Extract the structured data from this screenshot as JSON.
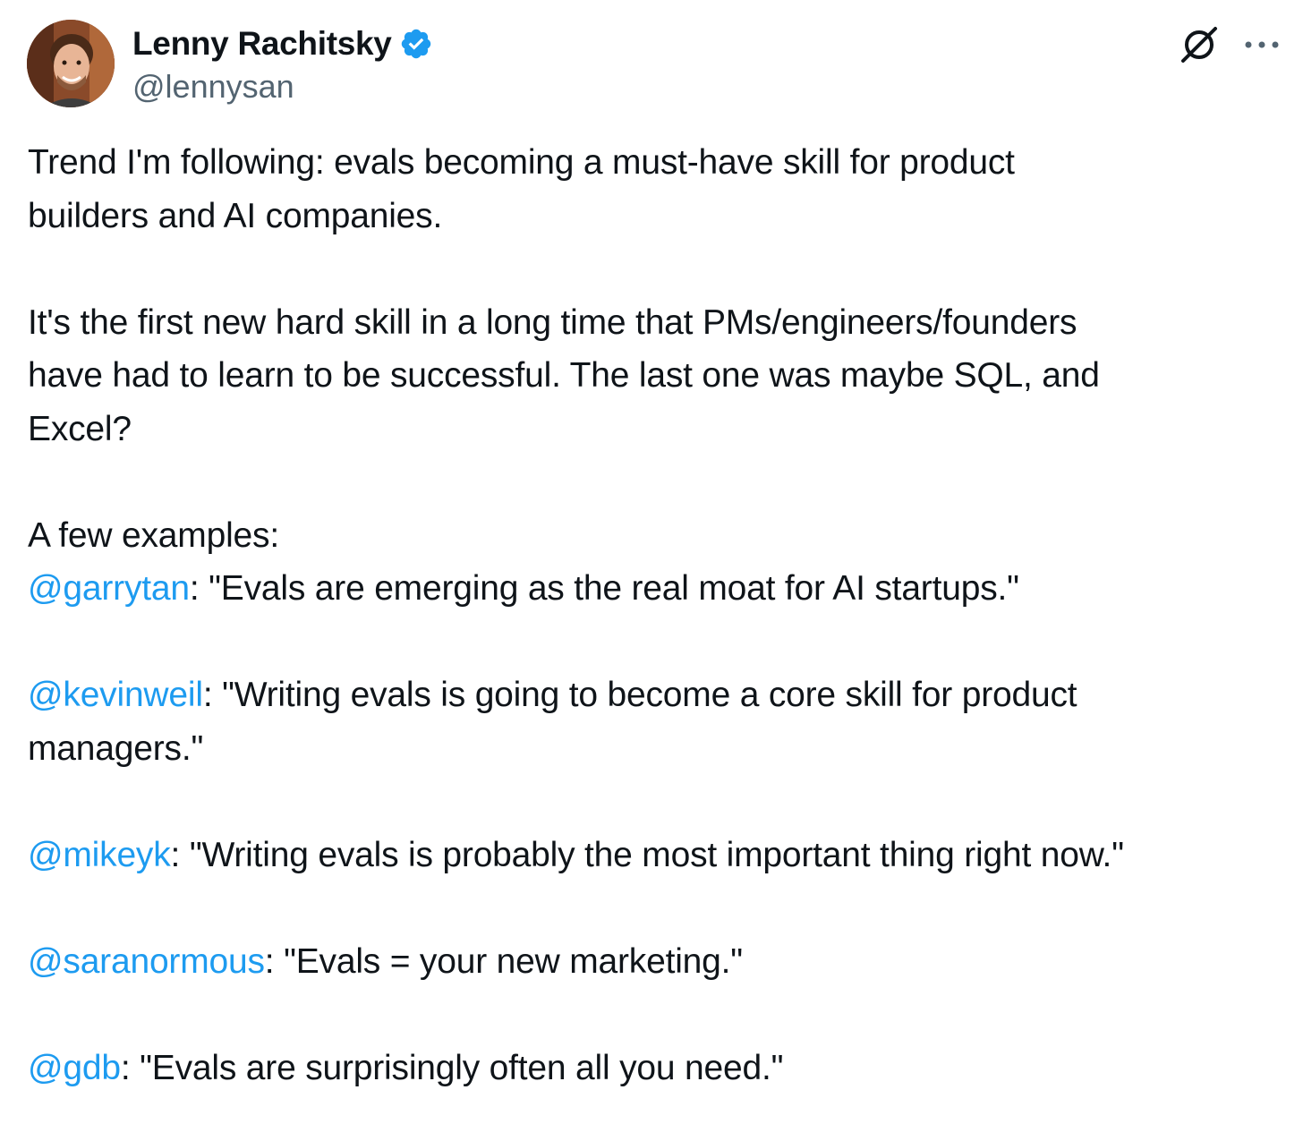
{
  "author": {
    "display_name": "Lenny Rachitsky",
    "handle": "@lennysan",
    "verified": true,
    "verified_color": "#1d9bf0"
  },
  "actions": {
    "grok_icon": "grok-icon",
    "more_icon": "more-options-icon"
  },
  "colors": {
    "text": "#0f1419",
    "secondary": "#536471",
    "mention": "#1d9bf0"
  },
  "tweet": {
    "p1_l1": "Trend I'm following: evals becoming a must-have skill for product",
    "p1_l2": "builders and AI companies.",
    "p2_l1": "It's the first new hard skill in a long time that PMs/engineers/founders",
    "p2_l2": "have had to learn to be successful. The last one was maybe SQL, and",
    "p2_l3": "Excel?",
    "p3_l1": "A few examples:",
    "quotes": [
      {
        "mention": "@garrytan",
        "text": ": \"Evals are emerging as the real moat for AI startups.\""
      },
      {
        "mention": "@kevinweil",
        "text": ": \"Writing evals is going to become a core skill for product",
        "text2": "managers.\""
      },
      {
        "mention": "@mikeyk",
        "text": ": \"Writing evals is probably the most important thing right now.\""
      },
      {
        "mention": "@saranormous",
        "text": ": \"Evals = your new marketing.\""
      },
      {
        "mention": "@gdb",
        "text": ": \"Evals are surprisingly often all you need.\""
      }
    ]
  }
}
